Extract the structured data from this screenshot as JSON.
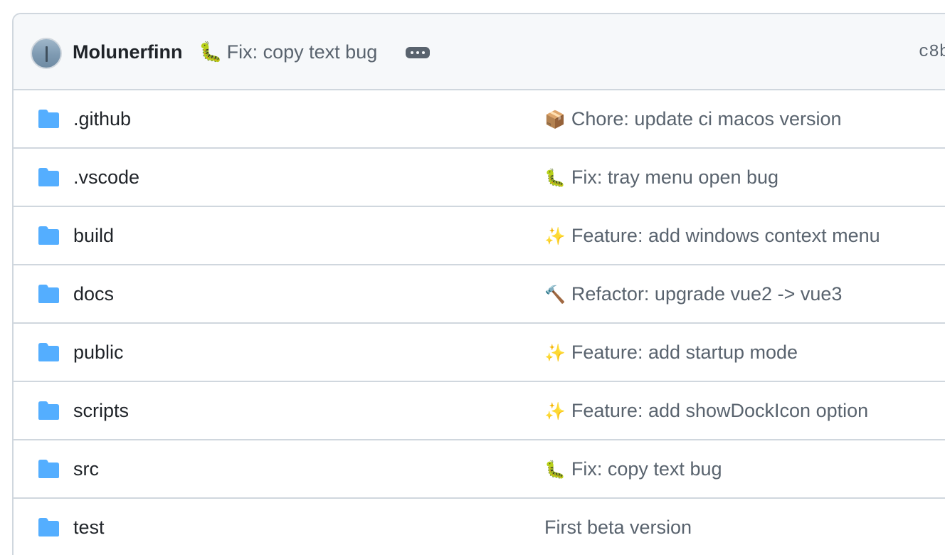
{
  "latest_commit": {
    "author": "Molunerfinn",
    "emoji": "🐛",
    "message": "Fix: copy text bug",
    "sha": "c8b"
  },
  "files": [
    {
      "name": ".github",
      "type": "folder",
      "emoji": "📦",
      "message": "Chore: update ci macos version"
    },
    {
      "name": ".vscode",
      "type": "folder",
      "emoji": "🐛",
      "message": "Fix: tray menu open bug"
    },
    {
      "name": "build",
      "type": "folder",
      "emoji": "✨",
      "message": "Feature: add windows context menu"
    },
    {
      "name": "docs",
      "type": "folder",
      "emoji": "🔨",
      "message": "Refactor: upgrade vue2 -> vue3"
    },
    {
      "name": "public",
      "type": "folder",
      "emoji": "✨",
      "message": "Feature: add startup mode"
    },
    {
      "name": "scripts",
      "type": "folder",
      "emoji": "✨",
      "message": "Feature: add showDockIcon option"
    },
    {
      "name": "src",
      "type": "folder",
      "emoji": "🐛",
      "message": "Fix: copy text bug"
    },
    {
      "name": "test",
      "type": "folder",
      "emoji": "",
      "message": "First beta version"
    }
  ],
  "colors": {
    "folder": "#54aeff",
    "border": "#d0d7de",
    "header_bg": "#f6f8fa",
    "muted_text": "#59636e"
  }
}
